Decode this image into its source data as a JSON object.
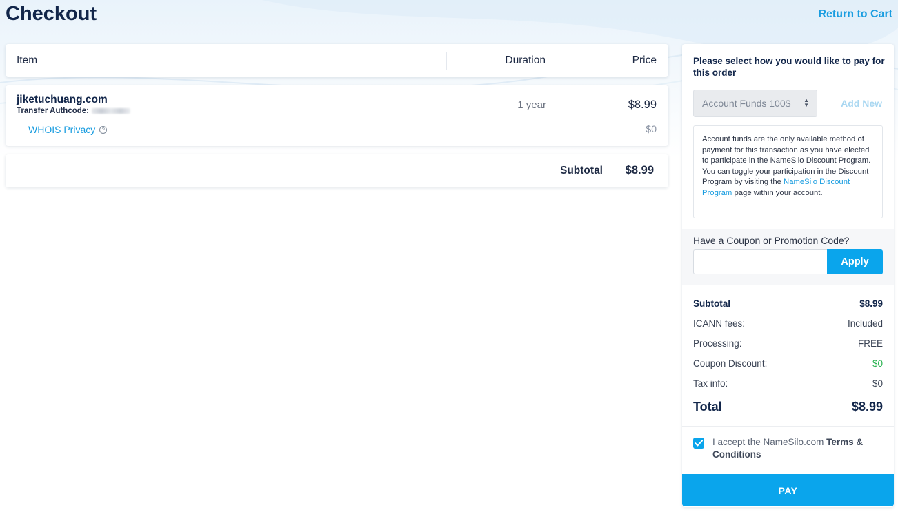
{
  "page": {
    "title": "Checkout",
    "return_link": "Return to Cart"
  },
  "cart_table": {
    "headers": {
      "item": "Item",
      "duration": "Duration",
      "price": "Price"
    },
    "items": [
      {
        "domain": "jiketuchuang.com",
        "authcode_label": "Transfer Authcode:",
        "duration": "1 year",
        "price": "$8.99",
        "addon_label": "WHOIS Privacy",
        "addon_price": "$0"
      }
    ],
    "subtotal_label": "Subtotal",
    "subtotal_value": "$8.99"
  },
  "payment": {
    "heading": "Please select how you would like to pay for this order",
    "method_selected": "Account Funds 100$",
    "add_new_label": "Add New",
    "note_part1": "Account funds are the only available method of payment for this transaction as you have elected to participate in the NameSilo Discount Program. You can toggle your participation in the Discount Program by visiting the ",
    "note_link": "NameSilo Discount Program",
    "note_part2": " page within your account."
  },
  "coupon": {
    "label": "Have a Coupon or Promotion Code?",
    "value": "",
    "apply_label": "Apply"
  },
  "summary": {
    "subtotal_label": "Subtotal",
    "subtotal_value": "$8.99",
    "icann_label": "ICANN fees:",
    "icann_value": "Included",
    "processing_label": "Processing:",
    "processing_value": "FREE",
    "coupon_label": "Coupon Discount:",
    "coupon_value": "$0",
    "tax_label": "Tax info:",
    "tax_value": "$0",
    "total_label": "Total",
    "total_value": "$8.99"
  },
  "terms": {
    "prefix": "I accept the NameSilo.com ",
    "link": "Terms & Conditions",
    "checked": true
  },
  "pay_button": "PAY",
  "colors": {
    "accent": "#0aa5ec",
    "link": "#1a9de0",
    "heading": "#12264a",
    "discount_green": "#22b04a"
  },
  "icons": {
    "help": "help-circle-icon",
    "select_arrows": "sort-arrows-icon",
    "checkbox": "checkmark-icon"
  }
}
